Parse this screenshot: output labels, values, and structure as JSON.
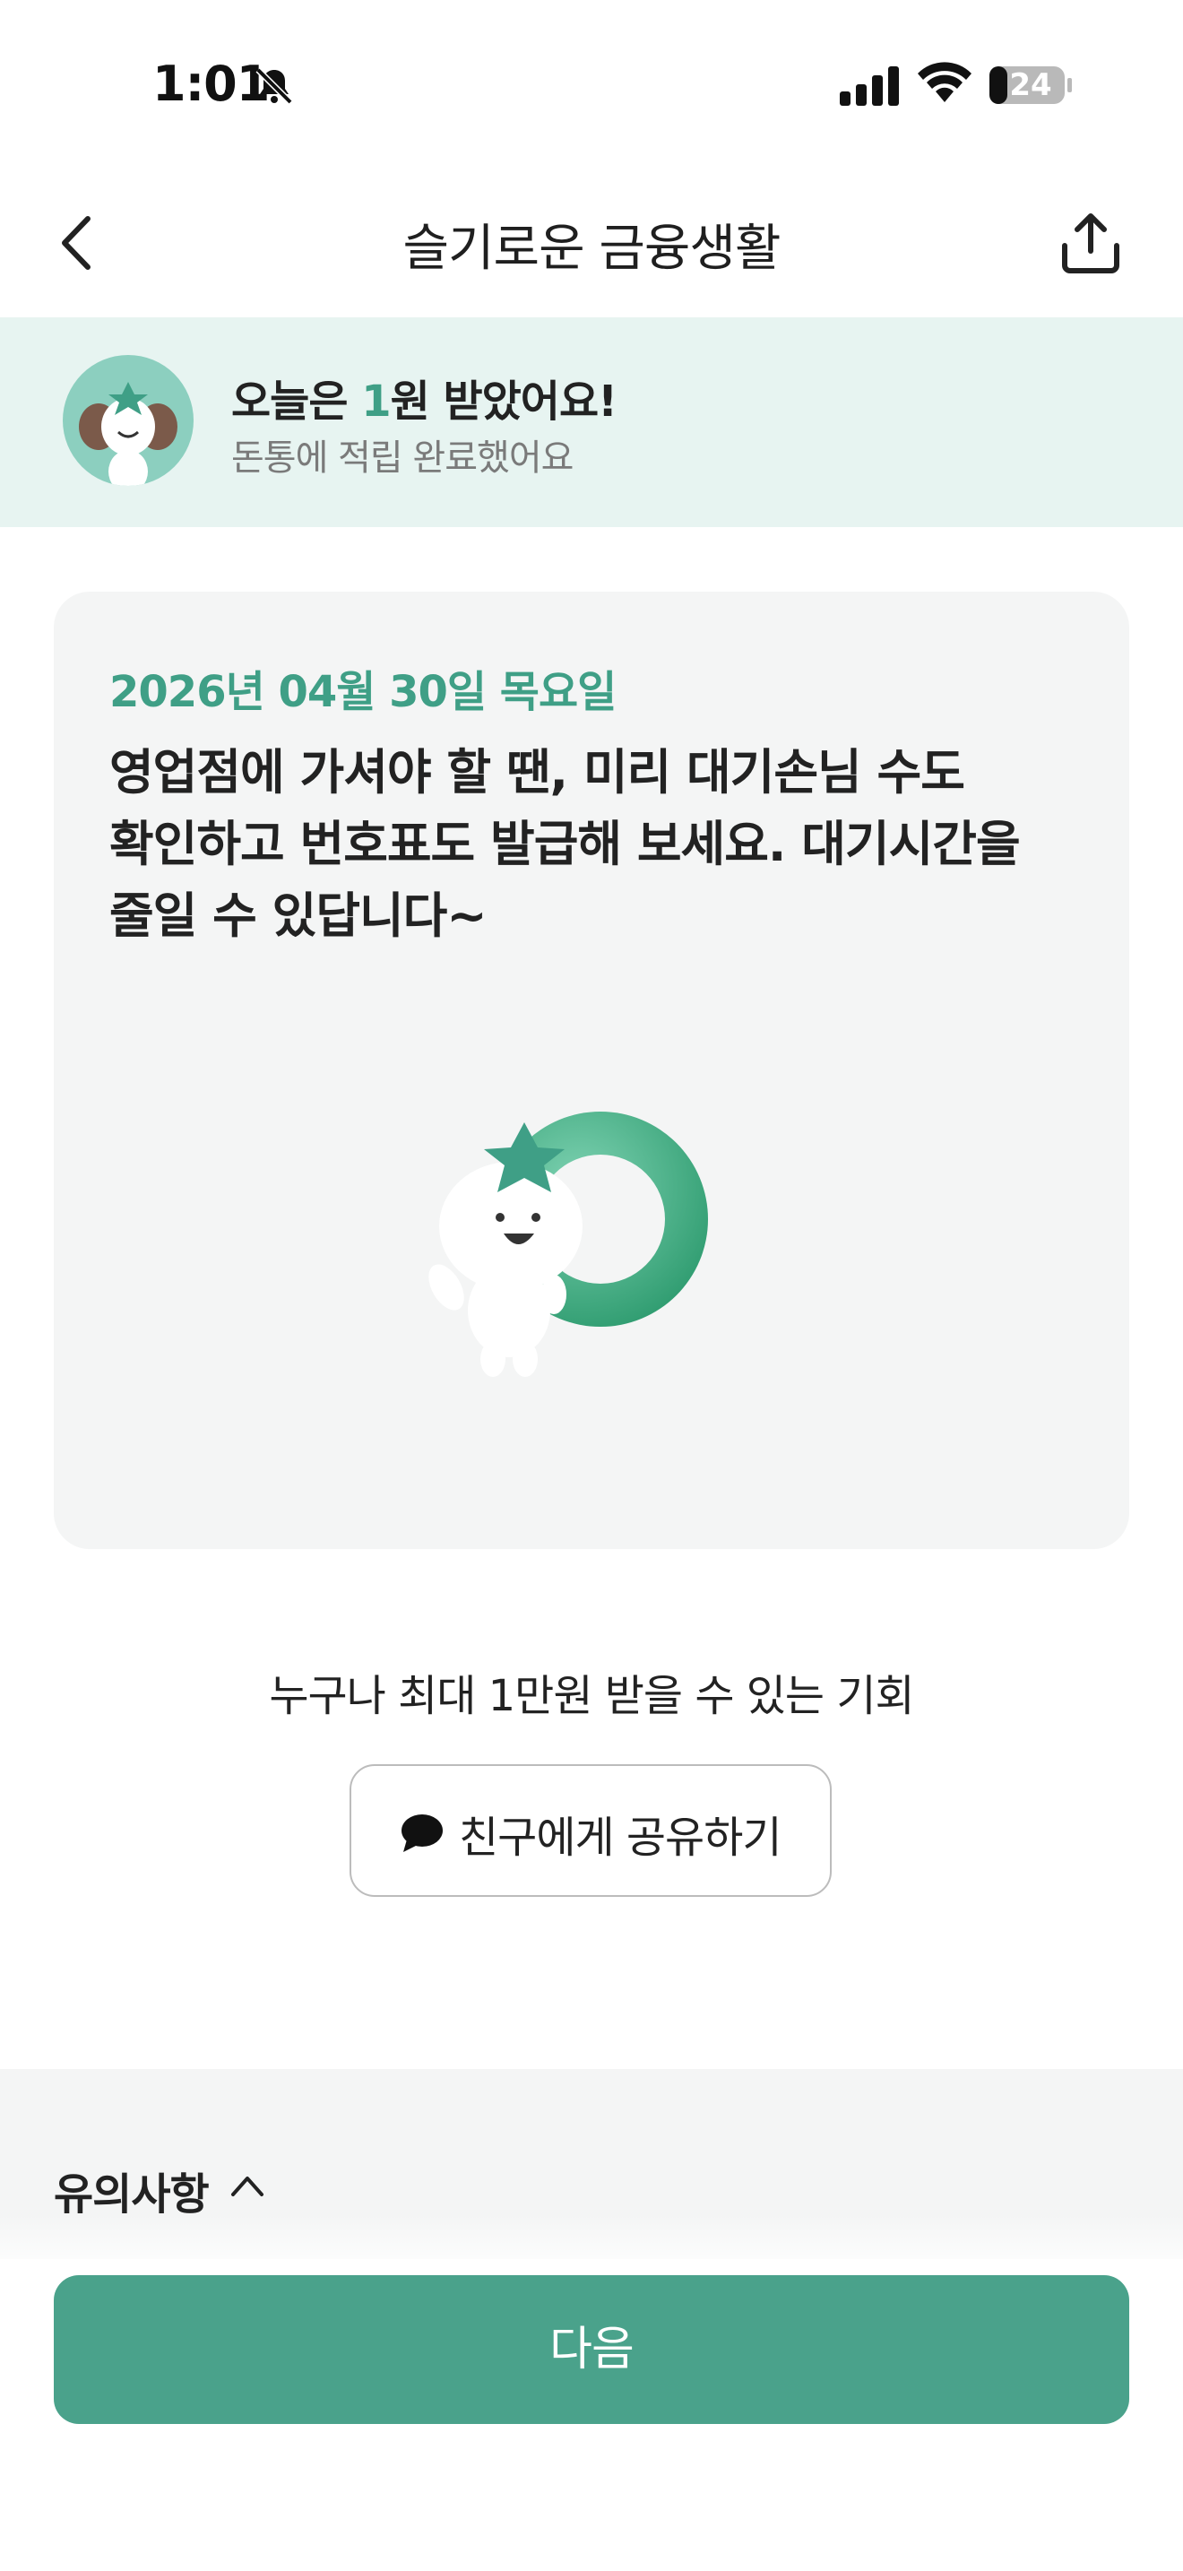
{
  "status_bar": {
    "time": "1:01",
    "battery": "24",
    "icons": [
      "bell-slash-icon",
      "signal-icon",
      "wifi-icon",
      "battery-icon"
    ]
  },
  "nav": {
    "title": "슬기로운 금융생활",
    "back_icon": "chevron-left-icon",
    "share_icon": "share-upload-icon"
  },
  "banner": {
    "title_prefix": "오늘은 ",
    "amount": "1",
    "title_suffix": "원 받았어요!",
    "subtitle": "돈통에 적립 완료했어요"
  },
  "card": {
    "date": "2026년 04월 30일 목요일",
    "lines": [
      "영업점에 가셔야 할 땐, 미리 대기손님 수도",
      "확인하고 번호표도 발급해 보세요. 대기시간을",
      "줄일 수 있답니다~"
    ]
  },
  "promo": {
    "chance_text": "누구나 최대 1만원 받을 수 있는 기회",
    "share_button": "친구에게 공유하기",
    "share_icon": "speech-bubble-icon"
  },
  "notice": {
    "label": "유의사항",
    "chevron_icon": "chevron-up-icon"
  },
  "footer": {
    "next_button": "다음"
  },
  "colors": {
    "accent": "#4aa28b",
    "accent_text": "#3f9f86",
    "banner_bg": "#e7f4f1",
    "card_bg": "#f4f5f5"
  }
}
